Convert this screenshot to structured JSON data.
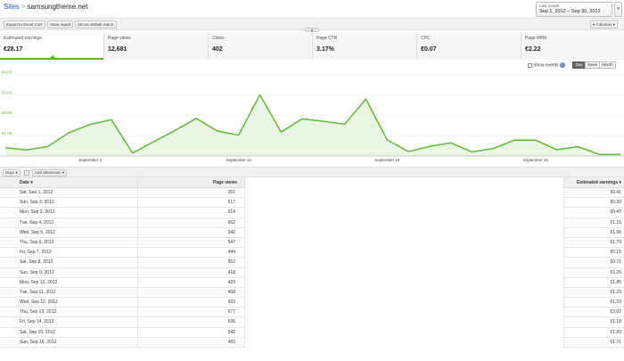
{
  "breadcrumb": {
    "root": "Sites",
    "separator": ">",
    "current": "samsungtheme.net"
  },
  "date_range": {
    "label": "Last month",
    "value": "Sep 1, 2012 – Sep 30, 2012",
    "arrow": "▾"
  },
  "toolbar": {
    "export": "Export to Excel CSV",
    "save": "Save report",
    "default": "Set as default report",
    "columns": "▾ Columns ▾"
  },
  "collapse_glyph": "▲",
  "metrics": [
    {
      "label": "Estimated earnings",
      "value": "€28.17"
    },
    {
      "label": "Page views",
      "value": "12,681"
    },
    {
      "label": "Clicks",
      "value": "402"
    },
    {
      "label": "Page CTR",
      "value": "3.17%"
    },
    {
      "label": "CPC",
      "value": "€0.07"
    },
    {
      "label": "Page RPM",
      "value": "€2.22"
    }
  ],
  "chart_controls": {
    "show_events": "Show events",
    "help": "?",
    "day": "Day",
    "week": "Week",
    "month": "Month"
  },
  "chart_data": {
    "type": "area",
    "series": [
      {
        "values": [
          0.41,
          0.3,
          0.47,
          1.15,
          1.56,
          1.79,
          0.15,
          0.71,
          1.26,
          1.85,
          1.23,
          1.03,
          3.02,
          1.18,
          1.83,
          1.71,
          1.57,
          2.81,
          0.8,
          0.22,
          0.47,
          0.65,
          0.2,
          0.37,
          0.78,
          0.78,
          0.31,
          0.46,
          0.08,
          0.08
        ]
      }
    ],
    "x": [
      1,
      2,
      3,
      4,
      5,
      6,
      7,
      8,
      9,
      10,
      11,
      12,
      13,
      14,
      15,
      16,
      17,
      18,
      19,
      20,
      21,
      22,
      23,
      24,
      25,
      26,
      27,
      28,
      29,
      30
    ],
    "x_tick_labels": [
      {
        "x": 5,
        "label": "September 5"
      },
      {
        "x": 12,
        "label": "September 12"
      },
      {
        "x": 19,
        "label": "September 19"
      },
      {
        "x": 26,
        "label": "September 26"
      }
    ],
    "y_tick_labels": [
      "€1.00",
      "€2.00",
      "€3.00",
      "€4.00"
    ],
    "y_ticks": [
      1,
      2,
      3,
      4
    ],
    "ylim": [
      0,
      4
    ],
    "line_color": "#5ab42e",
    "fill_color": "#eaf6e2"
  },
  "dimension": {
    "days": "Days ▾",
    "close": "×",
    "add": "Add dimension ▾"
  },
  "table": {
    "headers": {
      "date": "Date ▾",
      "page_views": "Page views",
      "earnings": "Estimated earnings ▾"
    },
    "rows": [
      {
        "date": "Sat, Sep 1, 2012",
        "pv": "251",
        "ee": "€0.41"
      },
      {
        "date": "Sun, Sep 2, 2012",
        "pv": "617",
        "ee": "€0.30"
      },
      {
        "date": "Mon, Sep 3, 2012",
        "pv": "614",
        "ee": "€0.47"
      },
      {
        "date": "Tue, Sep 4, 2012",
        "pv": "652",
        "ee": "€1.15"
      },
      {
        "date": "Wed, Sep 5, 2012",
        "pv": "340",
        "ee": "€1.56"
      },
      {
        "date": "Thu, Sep 6, 2012",
        "pv": "547",
        "ee": "€1.79"
      },
      {
        "date": "Fri, Sep 7, 2012",
        "pv": "444",
        "ee": "€0.15"
      },
      {
        "date": "Sat, Sep 8, 2012",
        "pv": "552",
        "ee": "€0.71"
      },
      {
        "date": "Sun, Sep 9, 2012",
        "pv": "418",
        "ee": "€1.26"
      },
      {
        "date": "Mon, Sep 10, 2012",
        "pv": "429",
        "ee": "€1.85"
      },
      {
        "date": "Tue, Sep 11, 2012",
        "pv": "458",
        "ee": "€1.23"
      },
      {
        "date": "Wed, Sep 12, 2012",
        "pv": "433",
        "ee": "€1.03"
      },
      {
        "date": "Thu, Sep 13, 2012",
        "pv": "677",
        "ee": "€3.02"
      },
      {
        "date": "Fri, Sep 14, 2012",
        "pv": "636",
        "ee": "€1.18"
      },
      {
        "date": "Sat, Sep 15, 2012",
        "pv": "642",
        "ee": "€1.83"
      },
      {
        "date": "Sun, Sep 16, 2012",
        "pv": "483",
        "ee": "€1.71"
      }
    ]
  }
}
